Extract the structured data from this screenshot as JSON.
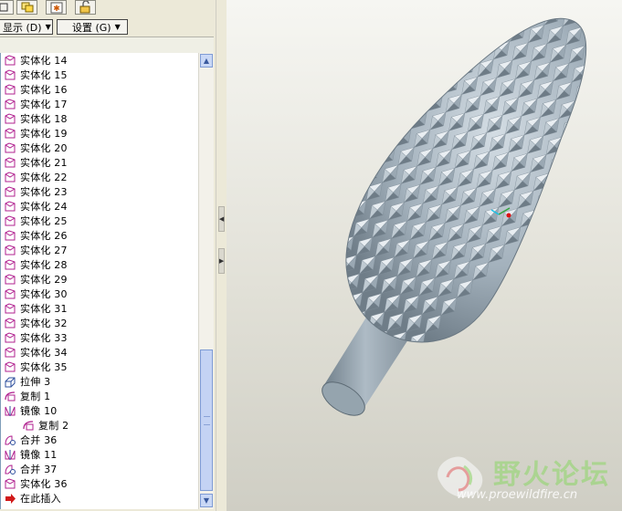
{
  "toolbar": {
    "icons": [
      "tree-filter-icon",
      "layer-icon",
      "star-icon",
      "settings-lock-icon"
    ]
  },
  "menus": {
    "show_label": "显示 (D)",
    "settings_label": "设置 (G)"
  },
  "tree": {
    "items": [
      {
        "icon": "solidify-icon",
        "label": "实体化 14",
        "indent": 0
      },
      {
        "icon": "solidify-icon",
        "label": "实体化 15",
        "indent": 0
      },
      {
        "icon": "solidify-icon",
        "label": "实体化 16",
        "indent": 0
      },
      {
        "icon": "solidify-icon",
        "label": "实体化 17",
        "indent": 0
      },
      {
        "icon": "solidify-icon",
        "label": "实体化 18",
        "indent": 0
      },
      {
        "icon": "solidify-icon",
        "label": "实体化 19",
        "indent": 0
      },
      {
        "icon": "solidify-icon",
        "label": "实体化 20",
        "indent": 0
      },
      {
        "icon": "solidify-icon",
        "label": "实体化 21",
        "indent": 0
      },
      {
        "icon": "solidify-icon",
        "label": "实体化 22",
        "indent": 0
      },
      {
        "icon": "solidify-icon",
        "label": "实体化 23",
        "indent": 0
      },
      {
        "icon": "solidify-icon",
        "label": "实体化 24",
        "indent": 0
      },
      {
        "icon": "solidify-icon",
        "label": "实体化 25",
        "indent": 0
      },
      {
        "icon": "solidify-icon",
        "label": "实体化 26",
        "indent": 0
      },
      {
        "icon": "solidify-icon",
        "label": "实体化 27",
        "indent": 0
      },
      {
        "icon": "solidify-icon",
        "label": "实体化 28",
        "indent": 0
      },
      {
        "icon": "solidify-icon",
        "label": "实体化 29",
        "indent": 0
      },
      {
        "icon": "solidify-icon",
        "label": "实体化 30",
        "indent": 0
      },
      {
        "icon": "solidify-icon",
        "label": "实体化 31",
        "indent": 0
      },
      {
        "icon": "solidify-icon",
        "label": "实体化 32",
        "indent": 0
      },
      {
        "icon": "solidify-icon",
        "label": "实体化 33",
        "indent": 0
      },
      {
        "icon": "solidify-icon",
        "label": "实体化 34",
        "indent": 0
      },
      {
        "icon": "solidify-icon",
        "label": "实体化 35",
        "indent": 0
      },
      {
        "icon": "extrude-icon",
        "label": "拉伸 3",
        "indent": 0
      },
      {
        "icon": "copy-icon",
        "label": "复制 1",
        "indent": 0
      },
      {
        "icon": "mirror-icon",
        "label": "镜像 10",
        "indent": 0
      },
      {
        "icon": "copy-icon",
        "label": "复制 2",
        "indent": 1
      },
      {
        "icon": "merge-icon",
        "label": "合并 36",
        "indent": 0
      },
      {
        "icon": "mirror-icon",
        "label": "镜像 11",
        "indent": 0
      },
      {
        "icon": "merge-icon",
        "label": "合并 37",
        "indent": 0
      },
      {
        "icon": "solidify-icon",
        "label": "实体化 36",
        "indent": 0
      },
      {
        "icon": "insert-here-icon",
        "label": "在此插入",
        "indent": 0
      }
    ]
  },
  "watermark": {
    "title": "野火论坛",
    "url": "www.proewildfire.cn"
  },
  "colors": {
    "model": "#a9b7c2",
    "background_top": "#f6f6f2",
    "background_bottom": "#cfcec4",
    "accent_magenta": "#b0208f"
  }
}
